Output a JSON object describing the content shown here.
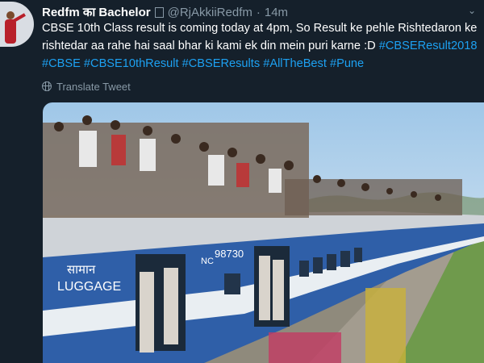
{
  "author": {
    "display_name": "Redfm का Bachelor",
    "verified_glyph": "▯",
    "handle": "@RjAkkiiRedfm",
    "separator": "·",
    "time": "14m"
  },
  "tweet": {
    "text_plain": "CBSE 10th Class result is coming today at 4pm, So Result ke pehle Rishtedaron ke rishtedar aa rahe hai saal bhar ki kami ek din mein puri karne :D ",
    "hashtags": [
      "#CBSEResult2018",
      "#CBSE",
      "#CBSE10thResult",
      "#CBSEResults",
      "#AllTheBest",
      "#Pune"
    ]
  },
  "actions": {
    "translate_label": "Translate Tweet",
    "more_icon": "chevron-down-icon"
  },
  "media": {
    "subject": "crowd on train",
    "coach_text": {
      "hindi": "सामान",
      "english": "LUGGAGE",
      "number": "98730",
      "prefix": "NC"
    }
  },
  "colors": {
    "background": "#15202b",
    "text": "#ffffff",
    "muted": "#8899a6",
    "link": "#1da1f2",
    "train_blue": "#2f5fa8"
  }
}
